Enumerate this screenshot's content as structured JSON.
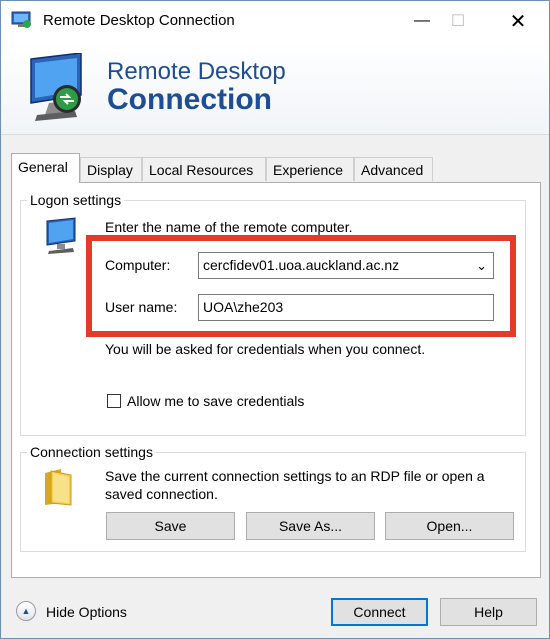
{
  "window": {
    "title": "Remote Desktop Connection"
  },
  "titlebar": {
    "minimize_glyph": "—",
    "maximize_glyph": "☐",
    "close_glyph": "✕"
  },
  "banner": {
    "line1": "Remote Desktop",
    "line2": "Connection"
  },
  "tabs": [
    {
      "label": "General",
      "active": true
    },
    {
      "label": "Display",
      "active": false
    },
    {
      "label": "Local Resources",
      "active": false
    },
    {
      "label": "Experience",
      "active": false
    },
    {
      "label": "Advanced",
      "active": false
    }
  ],
  "logon": {
    "legend": "Logon settings",
    "instruction": "Enter the name of the remote computer.",
    "computer_label": "Computer:",
    "computer_value": "cercfidev01.uoa.auckland.ac.nz",
    "username_label": "User name:",
    "username_value": "UOA\\zhe203",
    "credentials_note": "You will be asked for credentials when you connect.",
    "save_credentials_label": "Allow me to save credentials",
    "save_credentials_checked": false
  },
  "connection": {
    "legend": "Connection settings",
    "description_line1": "Save the current connection settings to an RDP file or open a",
    "description_line2": "saved connection.",
    "save_label": "Save",
    "save_as_label": "Save As...",
    "open_label": "Open..."
  },
  "footer": {
    "hide_options_label": "Hide Options",
    "connect_label": "Connect",
    "help_label": "Help"
  },
  "icons": {
    "app": "remote-desktop-icon",
    "computer": "computer-monitor-icon",
    "folder": "folder-icon",
    "hide_options": "chevron-up-icon",
    "dropdown": "chevron-down-icon"
  },
  "colors": {
    "accent": "#1f4d95",
    "highlight_box": "#e53a2a",
    "default_button_border": "#0078d7"
  }
}
